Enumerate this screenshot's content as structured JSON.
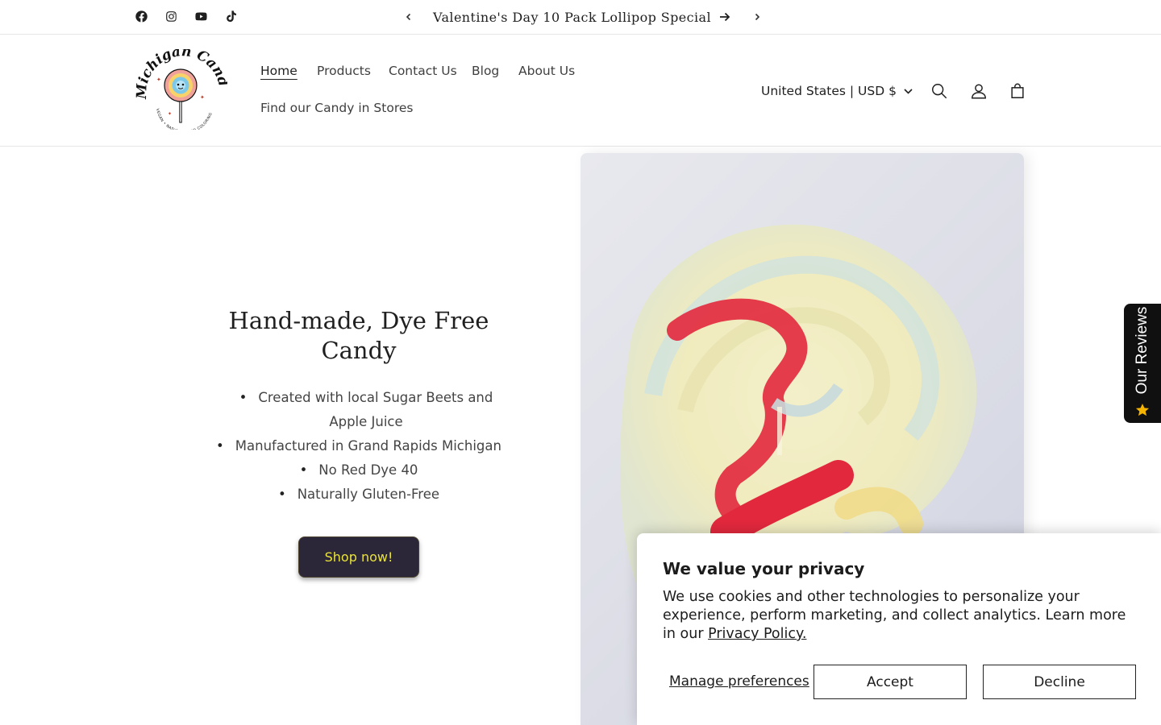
{
  "announcement": {
    "text": "Valentine's Day 10 Pack Lollipop Special",
    "prev_label": "Previous announcement",
    "next_label": "Next announcement"
  },
  "socials": [
    "facebook-icon",
    "instagram-icon",
    "youtube-icon",
    "tiktok-icon"
  ],
  "logo": {
    "line1": "Michigan Candyland",
    "line2": "VEGAN • NATURAL FOOD COLORING"
  },
  "nav": {
    "items": [
      "Home",
      "Products",
      "Contact Us",
      "Blog",
      "About Us",
      "Find our Candy in Stores"
    ],
    "active": "Home"
  },
  "header": {
    "country": "United States | USD $",
    "icons": [
      "search-icon",
      "account-icon",
      "cart-icon"
    ]
  },
  "hero": {
    "title": "Hand-made, Dye Free Candy",
    "bullets": [
      "Created with local Sugar Beets and Apple Juice",
      "Manufactured in Grand Rapids Michigan",
      "No Red Dye 40",
      "Naturally Gluten-Free"
    ],
    "cta": "Shop now!",
    "cta_colors": {
      "background": "#2b2638",
      "text": "#e9e33c"
    }
  },
  "reviews_tab": {
    "label": "Our Reviews",
    "icon": "star-icon"
  },
  "cookie": {
    "title": "We value your privacy",
    "body": "We use cookies and other technologies to personalize your experience, perform marketing, and collect analytics. Learn more in our ",
    "link": "Privacy Policy.",
    "manage": "Manage preferences",
    "accept": "Accept",
    "decline": "Decline"
  }
}
